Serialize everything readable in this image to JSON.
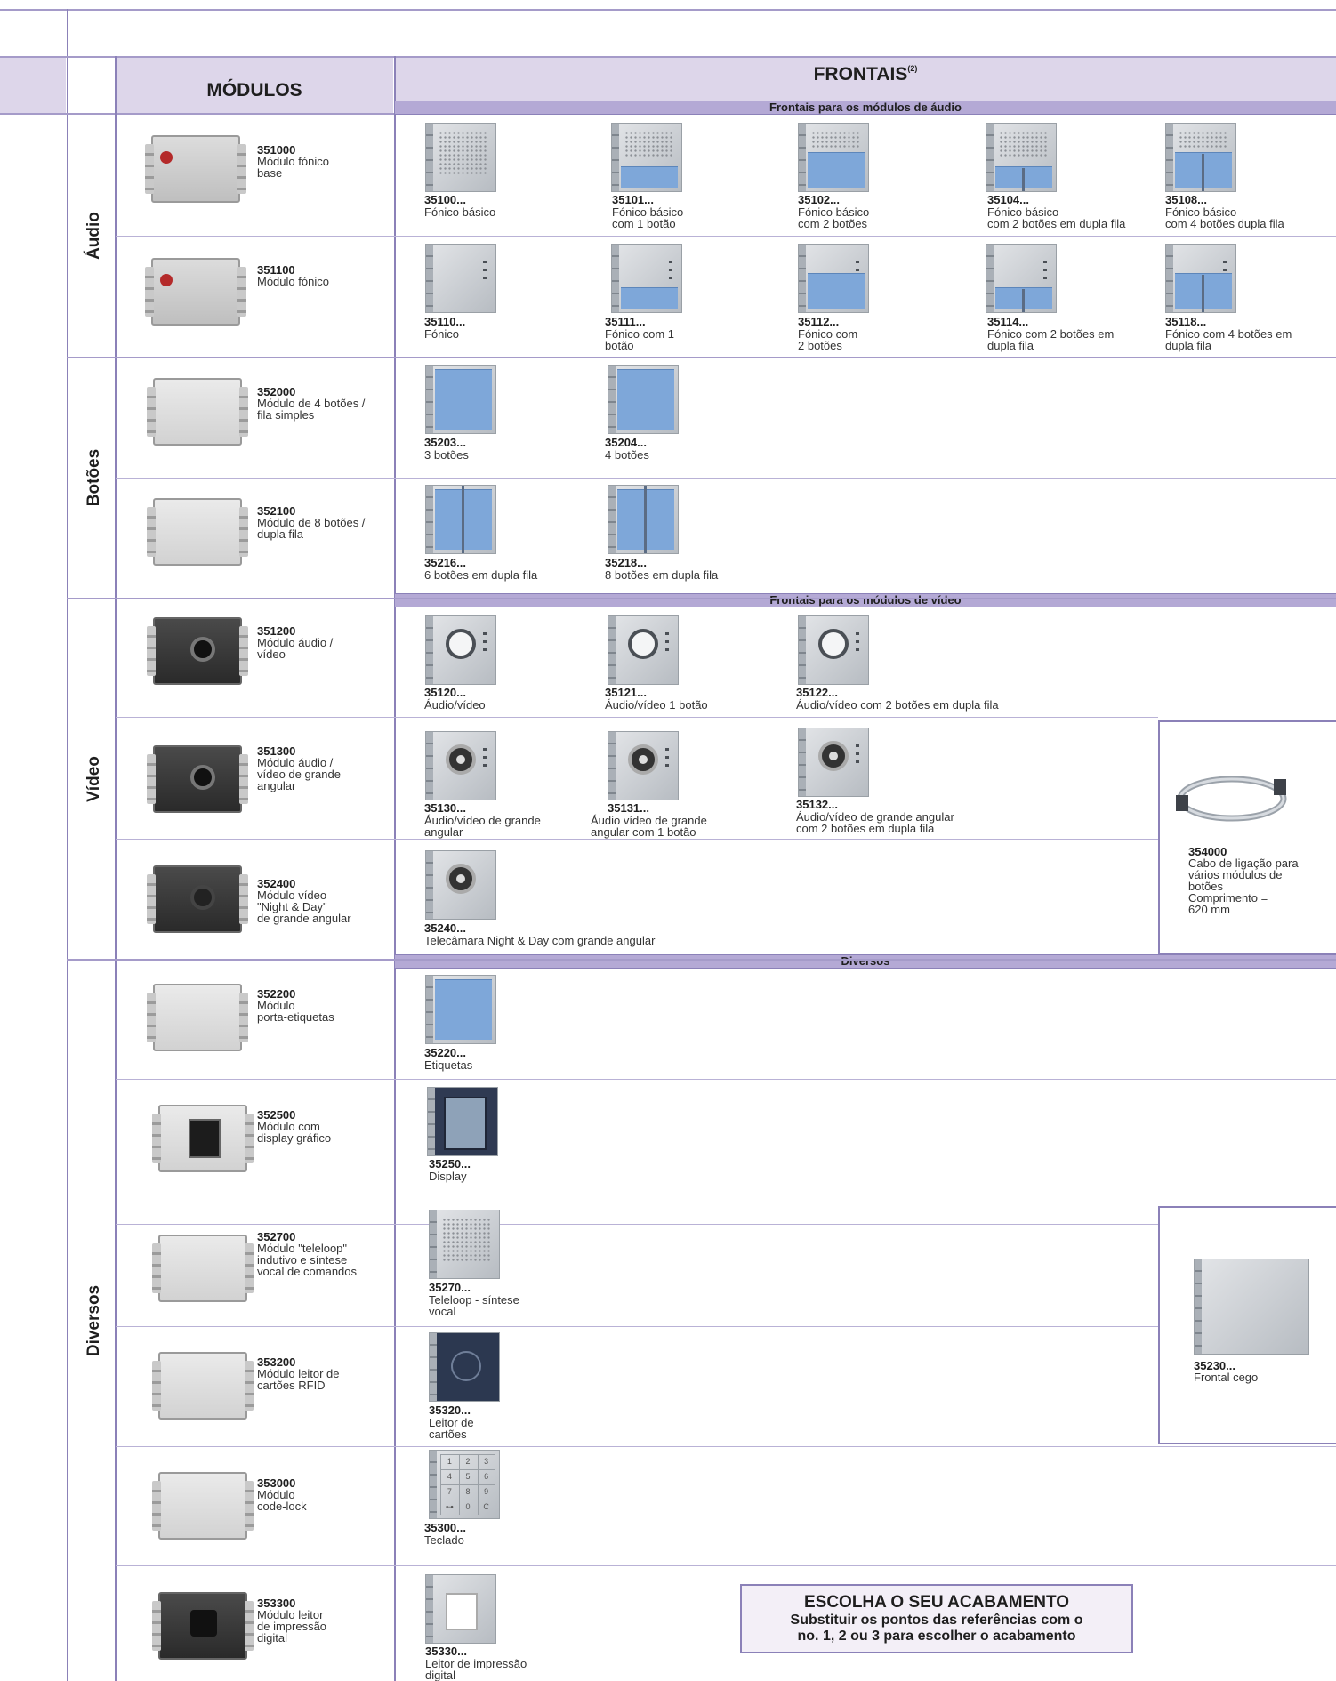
{
  "headers": {
    "modulos": "MÓDULOS",
    "frontais": "FRONTAIS",
    "frontais_note": "(2)"
  },
  "subsections": {
    "audio": "Frontais para os módulos de áudio",
    "video": "Frontais para os módulos de vídeo",
    "diversos": "Diversos"
  },
  "categories": {
    "audio": "Áudio",
    "botoes": "Botões",
    "video": "Vídeo",
    "diversos": "Diversos"
  },
  "modules": [
    {
      "code": "351000",
      "desc": "Módulo fónico\nbase"
    },
    {
      "code": "351100",
      "desc": "Módulo fónico"
    },
    {
      "code": "352000",
      "desc": "Módulo de 4 botões /\nfila simples"
    },
    {
      "code": "352100",
      "desc": "Módulo de 8 botões /\ndupla fila"
    },
    {
      "code": "351200",
      "desc": "Módulo áudio /\nvídeo"
    },
    {
      "code": "351300",
      "desc": "Módulo áudio /\nvídeo de grande\nangular"
    },
    {
      "code": "352400",
      "desc": "Módulo vídeo\n\"Night & Day\"\nde grande angular"
    },
    {
      "code": "352200",
      "desc": "Módulo\nporta-etiquetas"
    },
    {
      "code": "352500",
      "desc": "Módulo com\ndisplay gráfico"
    },
    {
      "code": "352700",
      "desc": "Módulo \"teleloop\"\nindutivo e síntese\nvocal de comandos"
    },
    {
      "code": "353200",
      "desc": "Módulo leitor de\ncartões RFID"
    },
    {
      "code": "353000",
      "desc": "Módulo\ncode-lock"
    },
    {
      "code": "353300",
      "desc": "Módulo leitor\nde impressão\ndigital"
    }
  ],
  "fronts": {
    "r1": [
      {
        "code": "35100...",
        "desc": "Fónico básico"
      },
      {
        "code": "35101...",
        "desc": "Fónico básico\ncom 1 botão"
      },
      {
        "code": "35102...",
        "desc": "Fónico básico\ncom 2 botões"
      },
      {
        "code": "35104...",
        "desc": "Fónico básico\ncom 2 botões em dupla fila"
      },
      {
        "code": "35108...",
        "desc": "Fónico básico\ncom 4 botões dupla fila"
      }
    ],
    "r2": [
      {
        "code": "35110...",
        "desc": "Fónico"
      },
      {
        "code": "35111...",
        "desc": "Fónico com 1\nbotão"
      },
      {
        "code": "35112...",
        "desc": "Fónico com\n2 botões"
      },
      {
        "code": "35114...",
        "desc": "Fónico com 2 botões em\ndupla fila"
      },
      {
        "code": "35118...",
        "desc": "Fónico com 4 botões em\ndupla fila"
      }
    ],
    "r3": [
      {
        "code": "35203...",
        "desc": "3 botões"
      },
      {
        "code": "35204...",
        "desc": "4 botões"
      }
    ],
    "r4": [
      {
        "code": "35216...",
        "desc": "6 botões em dupla fila"
      },
      {
        "code": "35218...",
        "desc": "8 botões em dupla fila"
      }
    ],
    "r5": [
      {
        "code": "35120...",
        "desc": "Áudio/vídeo"
      },
      {
        "code": "35121...",
        "desc": "Áudio/vídeo 1 botão"
      },
      {
        "code": "35122...",
        "desc": "Áudio/vídeo com 2 botões em dupla fila"
      }
    ],
    "r6": [
      {
        "code": "35130...",
        "desc": "Áudio/vídeo de grande\nangular"
      },
      {
        "code": "35131...",
        "desc": "Áudio vídeo de grande\nangular com 1 botão"
      },
      {
        "code": "35132...",
        "desc": "Áudio/vídeo de grande angular\ncom 2 botões em dupla fila"
      }
    ],
    "r7": [
      {
        "code": "35240...",
        "desc": "Telecâmara Night & Day com grande angular"
      }
    ],
    "r8": [
      {
        "code": "35220...",
        "desc": "Etiquetas"
      }
    ],
    "r9": [
      {
        "code": "35250...",
        "desc": "Display"
      }
    ],
    "r10": [
      {
        "code": "35270...",
        "desc": "Teleloop - síntese\nvocal"
      }
    ],
    "r11": [
      {
        "code": "35320...",
        "desc": "Leitor de\ncartões"
      }
    ],
    "r12": [
      {
        "code": "35300...",
        "desc": "Teclado"
      }
    ],
    "r13": [
      {
        "code": "35330...",
        "desc": "Leitor de impressão\ndigital"
      }
    ]
  },
  "sidebox_cable": {
    "code": "354000",
    "desc": "Cabo de ligação para\nvários módulos de\nbotões\nComprimento =\n620 mm"
  },
  "sidebox_blind": {
    "code": "35230...",
    "desc": "Frontal cego"
  },
  "keypad": [
    "1",
    "2",
    "3",
    "4",
    "5",
    "6",
    "7",
    "8",
    "9",
    "⊶",
    "0",
    "C"
  ],
  "choose": {
    "title": "ESCOLHA O SEU ACABAMENTO",
    "body": "Substituir os pontos das referências com o\nno. 1, 2 ou 3 para escolher o acabamento"
  }
}
